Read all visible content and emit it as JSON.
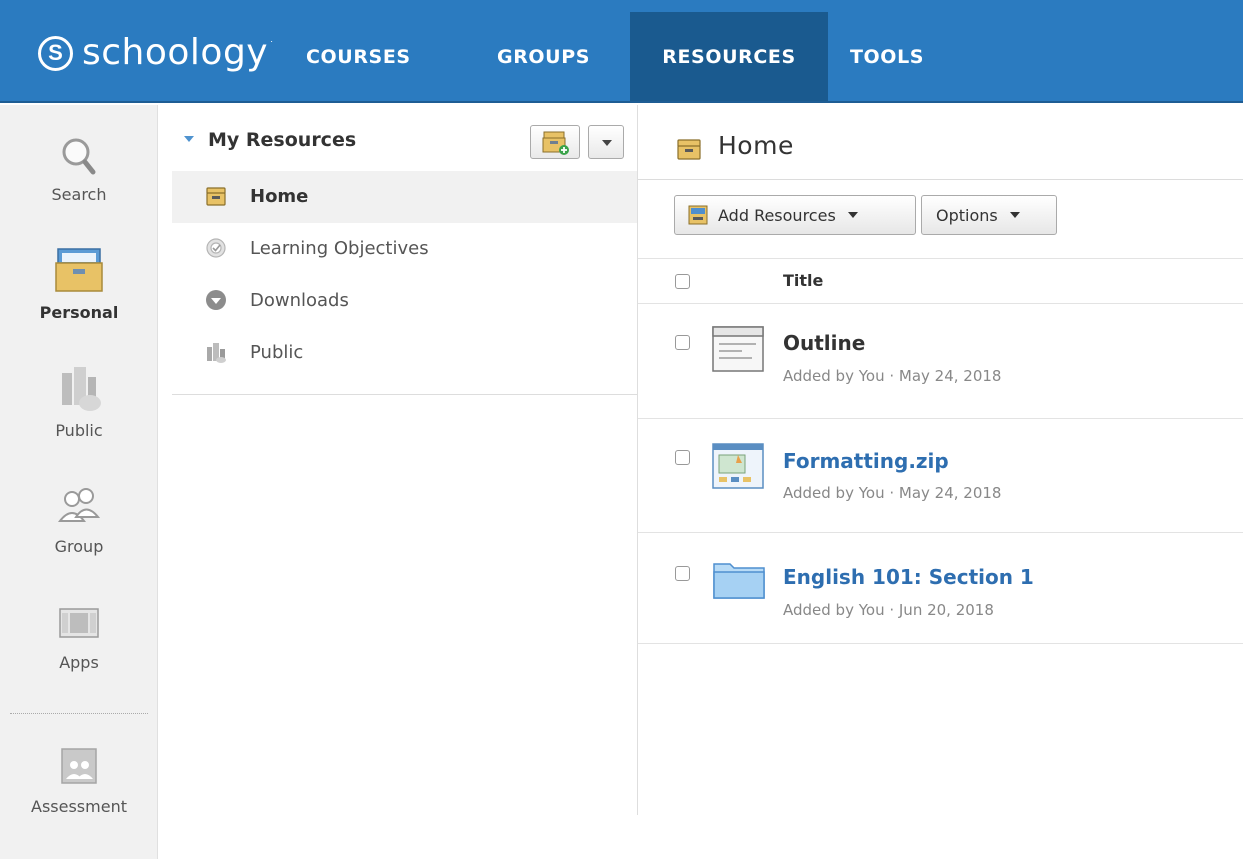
{
  "brand": {
    "mark": "S",
    "name": "schoology",
    "tm": "·"
  },
  "nav": {
    "courses": "COURSES",
    "groups": "GROUPS",
    "resources": "RESOURCES",
    "tools": "TOOLS"
  },
  "rail": {
    "search": "Search",
    "personal": "Personal",
    "public": "Public",
    "group": "Group",
    "apps": "Apps",
    "assessment": "Assessment"
  },
  "tree": {
    "title": "My Resources",
    "items": [
      {
        "label": "Home",
        "icon": "archive-box-icon",
        "active": true
      },
      {
        "label": "Learning Objectives",
        "icon": "target-icon",
        "active": false
      },
      {
        "label": "Downloads",
        "icon": "download-circle-icon",
        "active": false
      },
      {
        "label": "Public",
        "icon": "buildings-icon",
        "active": false
      }
    ]
  },
  "main": {
    "title": "Home",
    "add_resources_label": "Add Resources",
    "options_label": "Options",
    "col_title": "Title",
    "items": [
      {
        "name": "Outline",
        "meta": "Added by You · May 24, 2018",
        "icon": "page-icon",
        "style": "plain"
      },
      {
        "name": "Formatting.zip",
        "meta": "Added by You · May 24, 2018",
        "icon": "zip-file-icon",
        "style": "link"
      },
      {
        "name": "English 101: Section 1",
        "meta": "Added by You · Jun 20, 2018",
        "icon": "folder-icon",
        "style": "link"
      }
    ]
  },
  "colors": {
    "nav_bg": "#2b7bc0",
    "nav_active": "#1a5a8f",
    "link": "#2e6eb0",
    "archive": "#e8c266"
  }
}
